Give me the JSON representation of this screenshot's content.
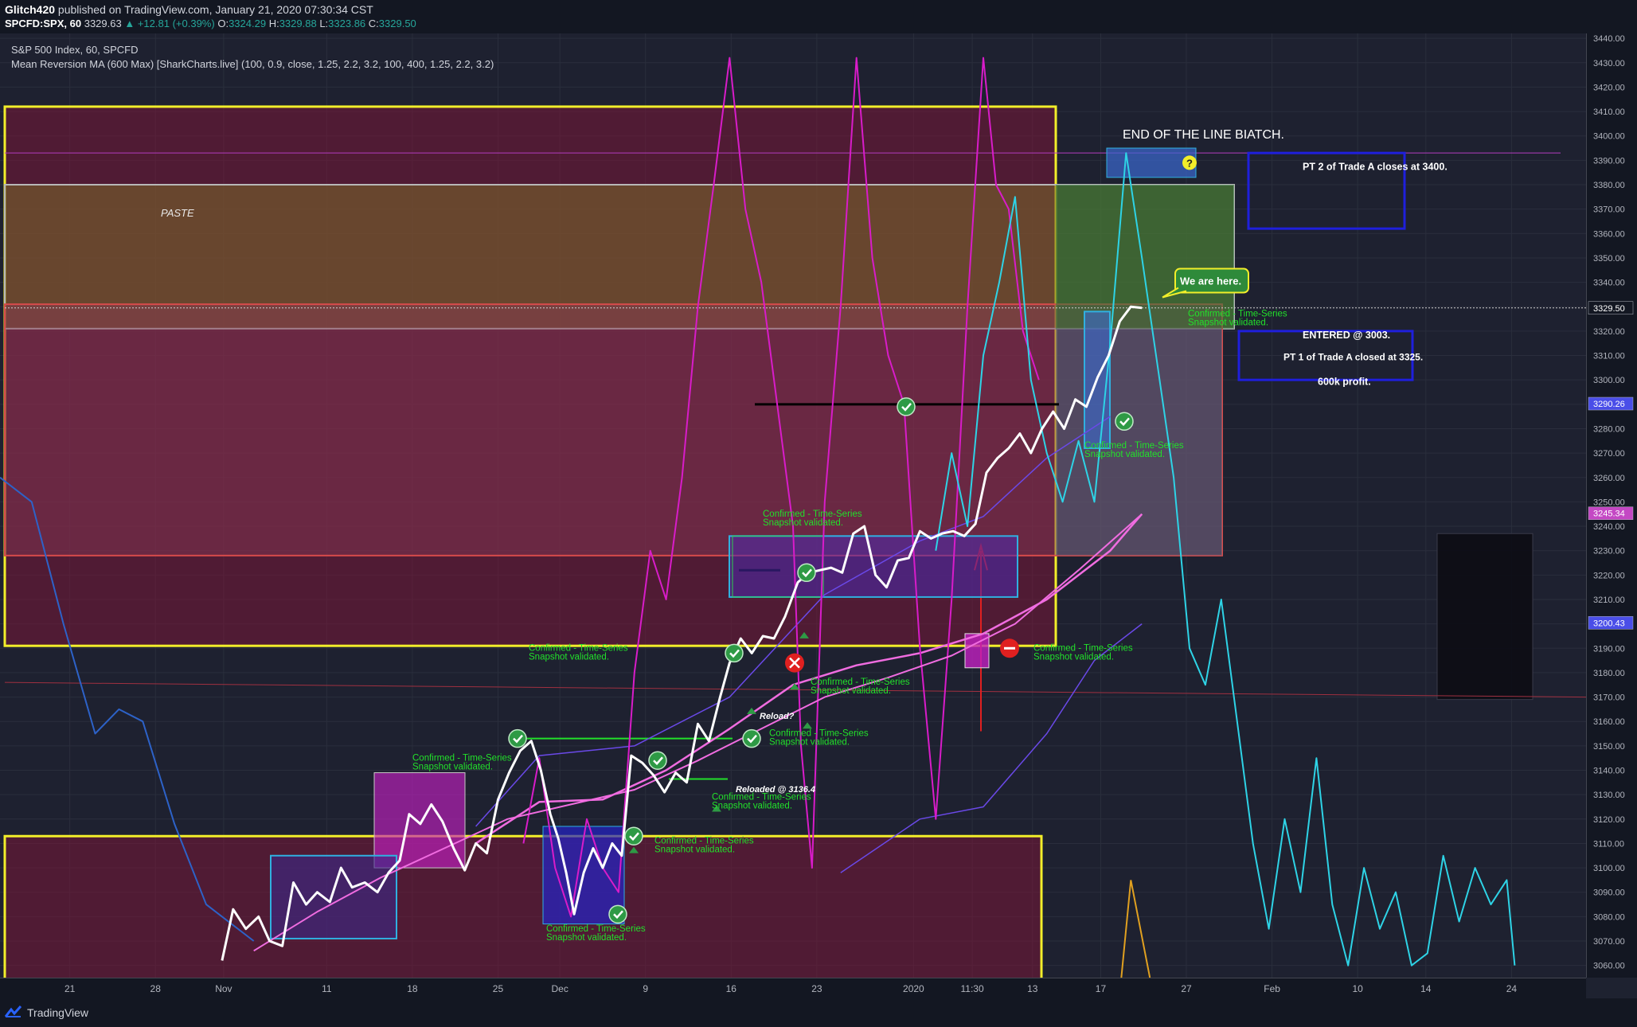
{
  "header": {
    "publisher": "Glitch420",
    "published_text": "published on TradingView.com, January 21, 2020 07:30:34 CST",
    "symbol": "SPCFD:SPX, 60",
    "last": "3329.63",
    "change": "+12.81 (+0.39%)",
    "o_label": "O:",
    "o": "3324.29",
    "h_label": "H:",
    "h": "3329.88",
    "l_label": "L:",
    "l": "3323.86",
    "c_label": "C:",
    "c": "3329.50"
  },
  "legend": {
    "series_title": "S&P 500 Index, 60, SPCFD",
    "indicator": "Mean Reversion MA (600 Max) [SharkCharts.live] (100, 0.9, close, 1.25, 2.2, 3.2, 100, 400, 1.25, 2.2, 3.2)"
  },
  "footer": {
    "brand": "TradingView"
  },
  "colors": {
    "price": "#ffffff",
    "oscillator_magenta": "#d81cc9",
    "oscillator_cyan": "#2ed3e6",
    "ma_pink": "#f06ce0",
    "ma_purple": "#6a49e8",
    "ma_blue": "#2d62c8",
    "annotation_green": "#22e02a",
    "box_yellow": "#f2ee2a",
    "box_blue": "#1f1fdc"
  },
  "chart_data": {
    "type": "line",
    "title": "S&P 500 Index, 60, SPCFD",
    "y_range": [
      3055,
      3442
    ],
    "price_ticks": [
      3440,
      3430,
      3420,
      3410,
      3400,
      3390,
      3380,
      3370,
      3360,
      3350,
      3340,
      3330,
      3320,
      3310,
      3300,
      3290,
      3280,
      3270,
      3260,
      3250,
      3240,
      3230,
      3220,
      3210,
      3200,
      3190,
      3180,
      3170,
      3160,
      3150,
      3140,
      3130,
      3120,
      3110,
      3100,
      3090,
      3080,
      3070,
      3060
    ],
    "price_labels_highlighted": [
      {
        "value": 3329.5,
        "text": "3329.50",
        "color": "#ffffff",
        "bg": "#131722"
      },
      {
        "value": 3290.26,
        "text": "3290.26",
        "color": "#ffffff",
        "bg": "#4a4ee8"
      },
      {
        "value": 3245.34,
        "text": "3245.34",
        "color": "#ffffff",
        "bg": "#c448c4"
      },
      {
        "value": 3200.43,
        "text": "3200.43",
        "color": "#ffffff",
        "bg": "#4a4ee8"
      }
    ],
    "time_ticks": [
      {
        "label": "21",
        "t": 0.044
      },
      {
        "label": "28",
        "t": 0.098
      },
      {
        "label": "Nov",
        "t": 0.141
      },
      {
        "label": "11",
        "t": 0.206
      },
      {
        "label": "18",
        "t": 0.26
      },
      {
        "label": "25",
        "t": 0.314
      },
      {
        "label": "Dec",
        "t": 0.353
      },
      {
        "label": "9",
        "t": 0.407
      },
      {
        "label": "16",
        "t": 0.461
      },
      {
        "label": "23",
        "t": 0.515
      },
      {
        "label": "2020",
        "t": 0.576
      },
      {
        "label": "11:30",
        "t": 0.613
      },
      {
        "label": "13",
        "t": 0.651
      },
      {
        "label": "17",
        "t": 0.694
      },
      {
        "label": "27",
        "t": 0.748
      },
      {
        "label": "Feb",
        "t": 0.802
      },
      {
        "label": "10",
        "t": 0.856
      },
      {
        "label": "14",
        "t": 0.899
      },
      {
        "label": "24",
        "t": 0.953
      }
    ],
    "series": [
      {
        "name": "S&P 500 Index",
        "points": [
          [
            0.14,
            3062
          ],
          [
            0.147,
            3083
          ],
          [
            0.155,
            3075
          ],
          [
            0.163,
            3080
          ],
          [
            0.17,
            3070
          ],
          [
            0.178,
            3068
          ],
          [
            0.185,
            3094
          ],
          [
            0.193,
            3085
          ],
          [
            0.2,
            3090
          ],
          [
            0.208,
            3086
          ],
          [
            0.215,
            3100
          ],
          [
            0.222,
            3092
          ],
          [
            0.23,
            3094
          ],
          [
            0.238,
            3090
          ],
          [
            0.245,
            3098
          ],
          [
            0.252,
            3103
          ],
          [
            0.258,
            3122
          ],
          [
            0.265,
            3118
          ],
          [
            0.272,
            3126
          ],
          [
            0.279,
            3119
          ],
          [
            0.286,
            3108
          ],
          [
            0.293,
            3099
          ],
          [
            0.3,
            3110
          ],
          [
            0.307,
            3106
          ],
          [
            0.314,
            3128
          ],
          [
            0.321,
            3139
          ],
          [
            0.328,
            3148
          ],
          [
            0.335,
            3152
          ],
          [
            0.341,
            3140
          ],
          [
            0.347,
            3122
          ],
          [
            0.352,
            3112
          ],
          [
            0.357,
            3098
          ],
          [
            0.362,
            3081
          ],
          [
            0.368,
            3098
          ],
          [
            0.374,
            3108
          ],
          [
            0.38,
            3100
          ],
          [
            0.386,
            3110
          ],
          [
            0.392,
            3105
          ],
          [
            0.398,
            3146
          ],
          [
            0.405,
            3143
          ],
          [
            0.412,
            3138
          ],
          [
            0.419,
            3131
          ],
          [
            0.426,
            3139
          ],
          [
            0.433,
            3135
          ],
          [
            0.44,
            3159
          ],
          [
            0.447,
            3152
          ],
          [
            0.454,
            3170
          ],
          [
            0.46,
            3184
          ],
          [
            0.467,
            3194
          ],
          [
            0.474,
            3188
          ],
          [
            0.481,
            3195
          ],
          [
            0.488,
            3194
          ],
          [
            0.495,
            3203
          ],
          [
            0.503,
            3217
          ],
          [
            0.51,
            3221
          ],
          [
            0.517,
            3222
          ],
          [
            0.524,
            3223
          ],
          [
            0.531,
            3221
          ],
          [
            0.538,
            3237
          ],
          [
            0.545,
            3240
          ],
          [
            0.552,
            3220
          ],
          [
            0.559,
            3215
          ],
          [
            0.566,
            3226
          ],
          [
            0.573,
            3227
          ],
          [
            0.58,
            3238
          ],
          [
            0.587,
            3235
          ],
          [
            0.594,
            3237
          ],
          [
            0.601,
            3238
          ],
          [
            0.608,
            3236
          ],
          [
            0.615,
            3241
          ],
          [
            0.622,
            3262
          ],
          [
            0.629,
            3268
          ],
          [
            0.636,
            3272
          ],
          [
            0.643,
            3278
          ],
          [
            0.65,
            3270
          ],
          [
            0.657,
            3280
          ],
          [
            0.664,
            3287
          ],
          [
            0.671,
            3280
          ],
          [
            0.678,
            3292
          ],
          [
            0.685,
            3289
          ],
          [
            0.692,
            3301
          ],
          [
            0.699,
            3310
          ],
          [
            0.706,
            3324
          ],
          [
            0.713,
            3330
          ],
          [
            0.72,
            3329.5
          ]
        ]
      },
      {
        "name": "Mean Reversion MA",
        "points": [
          [
            0.16,
            3066
          ],
          [
            0.2,
            3082
          ],
          [
            0.24,
            3096
          ],
          [
            0.28,
            3108
          ],
          [
            0.32,
            3120
          ],
          [
            0.36,
            3126
          ],
          [
            0.4,
            3132
          ],
          [
            0.44,
            3144
          ],
          [
            0.48,
            3157
          ],
          [
            0.52,
            3170
          ],
          [
            0.56,
            3178
          ],
          [
            0.6,
            3187
          ],
          [
            0.64,
            3200
          ],
          [
            0.68,
            3222
          ],
          [
            0.72,
            3245
          ]
        ]
      },
      {
        "name": "Oscillator",
        "points": [
          [
            0.33,
            3110
          ],
          [
            0.34,
            3145
          ],
          [
            0.35,
            3100
          ],
          [
            0.36,
            3080
          ],
          [
            0.37,
            3120
          ],
          [
            0.38,
            3100
          ],
          [
            0.39,
            3090
          ],
          [
            0.4,
            3180
          ],
          [
            0.41,
            3230
          ],
          [
            0.42,
            3210
          ],
          [
            0.43,
            3260
          ],
          [
            0.44,
            3330
          ],
          [
            0.45,
            3380
          ],
          [
            0.46,
            3432
          ],
          [
            0.47,
            3370
          ],
          [
            0.48,
            3340
          ],
          [
            0.49,
            3290
          ],
          [
            0.5,
            3240
          ],
          [
            0.505,
            3150
          ],
          [
            0.512,
            3100
          ],
          [
            0.52,
            3250
          ],
          [
            0.53,
            3330
          ],
          [
            0.54,
            3432
          ],
          [
            0.55,
            3350
          ],
          [
            0.56,
            3310
          ],
          [
            0.57,
            3290
          ],
          [
            0.58,
            3190
          ],
          [
            0.59,
            3120
          ],
          [
            0.6,
            3210
          ],
          [
            0.61,
            3330
          ],
          [
            0.62,
            3432
          ],
          [
            0.628,
            3380
          ],
          [
            0.636,
            3370
          ],
          [
            0.645,
            3320
          ],
          [
            0.655,
            3300
          ]
        ]
      },
      {
        "name": "Cyan oscillator",
        "points": [
          [
            0.59,
            3230
          ],
          [
            0.6,
            3270
          ],
          [
            0.61,
            3240
          ],
          [
            0.62,
            3310
          ],
          [
            0.63,
            3340
          ],
          [
            0.64,
            3375
          ],
          [
            0.65,
            3300
          ],
          [
            0.66,
            3270
          ],
          [
            0.67,
            3250
          ],
          [
            0.68,
            3275
          ],
          [
            0.69,
            3250
          ],
          [
            0.7,
            3315
          ],
          [
            0.71,
            3393
          ],
          [
            0.72,
            3350
          ],
          [
            0.73,
            3305
          ],
          [
            0.74,
            3260
          ],
          [
            0.75,
            3190
          ],
          [
            0.76,
            3175
          ],
          [
            0.77,
            3210
          ],
          [
            0.78,
            3160
          ],
          [
            0.79,
            3110
          ],
          [
            0.8,
            3075
          ],
          [
            0.81,
            3120
          ],
          [
            0.82,
            3090
          ],
          [
            0.83,
            3145
          ],
          [
            0.84,
            3085
          ],
          [
            0.85,
            3060
          ],
          [
            0.86,
            3100
          ],
          [
            0.87,
            3075
          ],
          [
            0.88,
            3090
          ],
          [
            0.89,
            3060
          ],
          [
            0.9,
            3065
          ],
          [
            0.91,
            3105
          ],
          [
            0.92,
            3078
          ],
          [
            0.93,
            3100
          ],
          [
            0.94,
            3085
          ],
          [
            0.95,
            3095
          ],
          [
            0.955,
            3060
          ]
        ]
      }
    ],
    "annotations": [
      {
        "text": "PASTE"
      },
      {
        "text": "END OF THE LINE BIATCH."
      },
      {
        "text": "We are here."
      },
      {
        "text": "PT 2 of Trade A closes at 3400."
      },
      {
        "text": "ENTERED @ 3003."
      },
      {
        "text": "PT 1 of Trade A closed at 3325."
      },
      {
        "text": "600k profit."
      },
      {
        "text": "Reload?"
      },
      {
        "text": "Reloaded @ 3136.4"
      },
      {
        "text": "Confirmed - Time-Series Snapshot validated."
      }
    ]
  }
}
